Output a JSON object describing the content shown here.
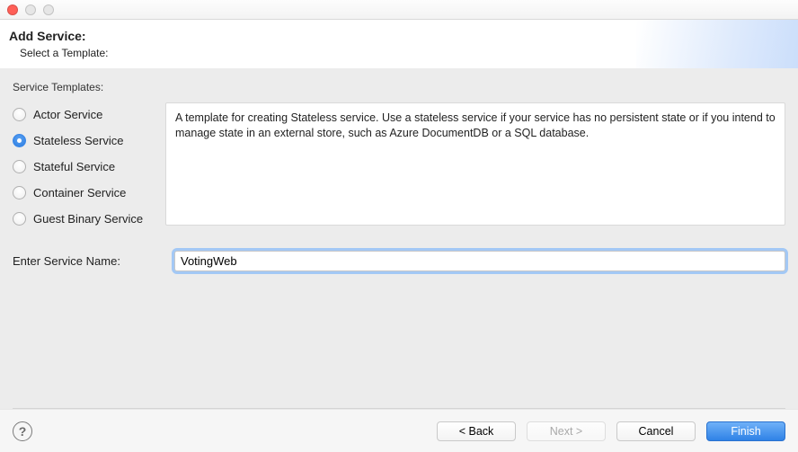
{
  "header": {
    "title": "Add Service:",
    "subtitle": "Select a Template:"
  },
  "group": {
    "label": "Service Templates:"
  },
  "templates": [
    {
      "label": "Actor Service",
      "selected": false
    },
    {
      "label": "Stateless Service",
      "selected": true
    },
    {
      "label": "Stateful Service",
      "selected": false
    },
    {
      "label": "Container Service",
      "selected": false
    },
    {
      "label": "Guest Binary Service",
      "selected": false
    }
  ],
  "description": "A template for creating Stateless service.  Use a stateless service if your service has no persistent state or if you intend to manage state in an external store, such as Azure DocumentDB or a SQL database.",
  "service_name": {
    "label": "Enter Service Name:",
    "value": "VotingWeb"
  },
  "buttons": {
    "back": "< Back",
    "next": "Next >",
    "cancel": "Cancel",
    "finish": "Finish"
  },
  "help": {
    "glyph": "?"
  },
  "colors": {
    "accent": "#2f82e6",
    "focus_ring": "#a3c8f5"
  }
}
